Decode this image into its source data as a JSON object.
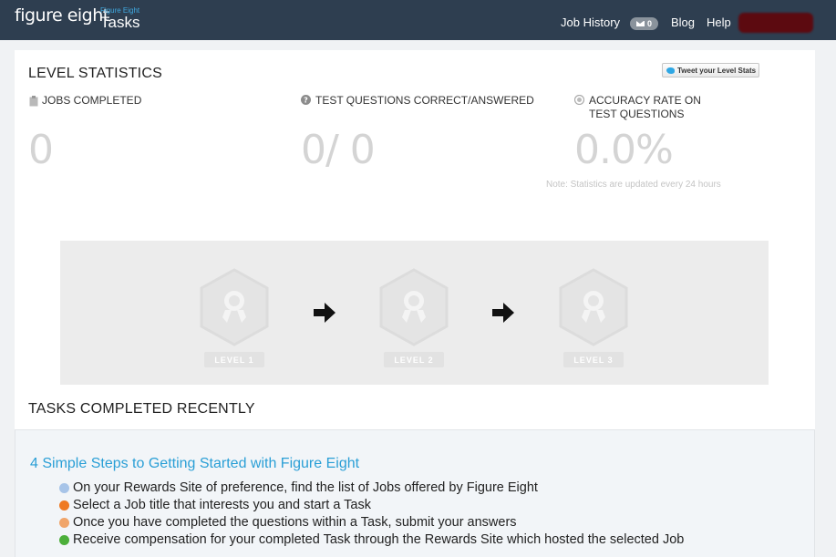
{
  "navbar": {
    "logo_text": "figure eight",
    "brand_subtitle": "Figure Eight",
    "brand_title": "Tasks",
    "links": {
      "job_history": "Job History",
      "messages_count": "0",
      "blog": "Blog",
      "help": "Help"
    },
    "icons": {
      "messages": "envelope-icon"
    },
    "colors": {
      "background": "#2e3e50",
      "subtitle": "#3fa9e0"
    }
  },
  "level_statistics": {
    "title": "LEVEL STATISTICS",
    "tweet_button": "Tweet your Level Stats",
    "stats": [
      {
        "icon": "clipboard-icon",
        "label": "JOBS COMPLETED",
        "value": "0"
      },
      {
        "icon": "question-circle-icon",
        "label": "TEST QUESTIONS CORRECT/ANSWERED",
        "value": "0/ 0"
      },
      {
        "icon": "target-icon",
        "label_line1": "ACCURACY RATE ON",
        "label_line2": "TEST QUESTIONS",
        "value": "0.0%"
      }
    ],
    "note": "Note: Statistics are updated every 24 hours"
  },
  "levels": {
    "badges": [
      {
        "label": "LEVEL 1",
        "icon": "award-ribbon-icon"
      },
      {
        "label": "LEVEL 2",
        "icon": "award-ribbon-icon"
      },
      {
        "label": "LEVEL 3",
        "icon": "award-ribbon-icon"
      }
    ],
    "arrow_icon": "arrow-right-icon"
  },
  "tasks_recent": {
    "title": "TASKS COMPLETED RECENTLY"
  },
  "getting_started": {
    "title": "4 Simple Steps to Getting Started with Figure Eight",
    "steps": [
      {
        "text": "On your Rewards Site of preference, find the list of Jobs offered by Figure Eight",
        "color": "#a7c4e8"
      },
      {
        "text": "Select a Job title that interests you and start a Task",
        "color": "#ef7a23"
      },
      {
        "text": "Once you have completed the questions within a Task, submit your answers",
        "color": "#f0a56a"
      },
      {
        "text": "Receive compensation for your completed Task through the Rewards Site which hosted the selected Job",
        "color": "#4caf3a"
      }
    ]
  }
}
